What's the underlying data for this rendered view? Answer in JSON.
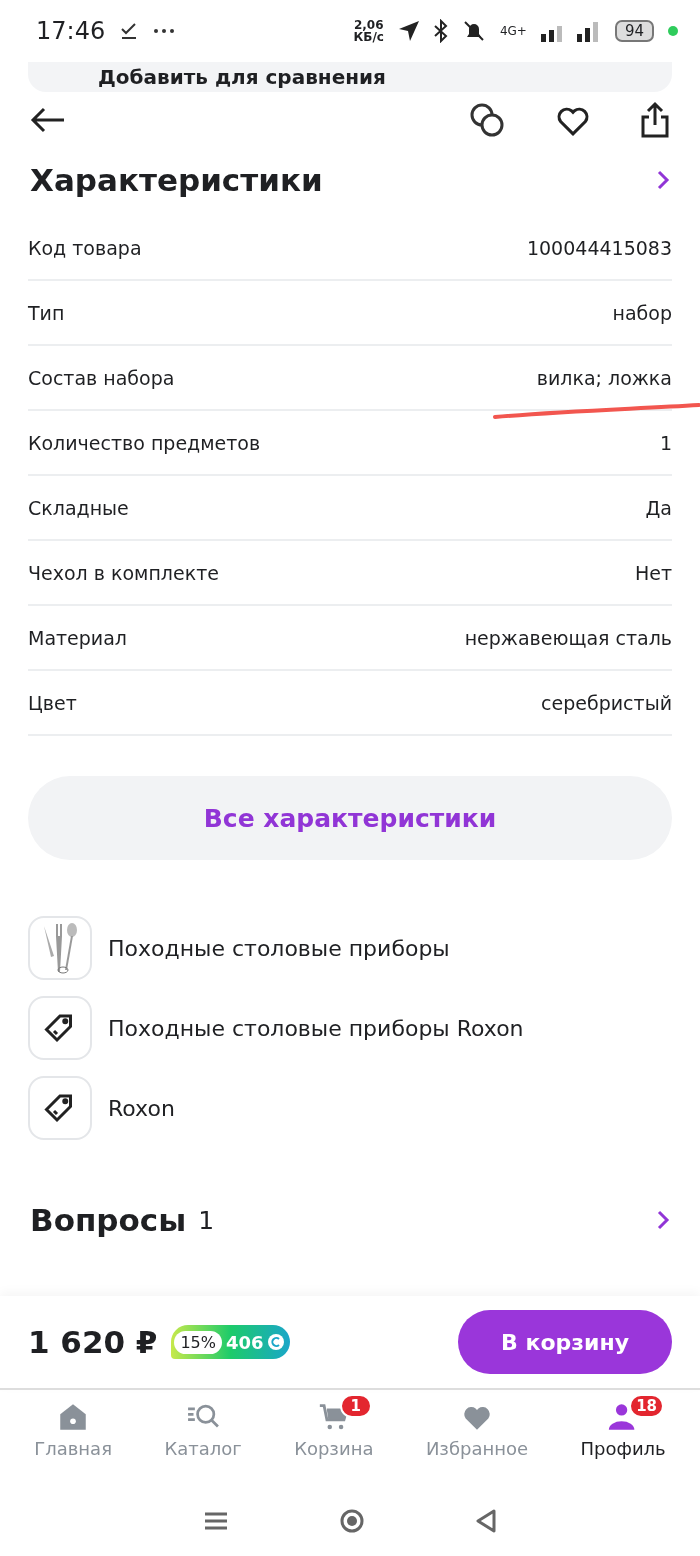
{
  "status_bar": {
    "time": "17:46",
    "speed": "2,06",
    "speed_unit": "КБ/с",
    "network": "4G+",
    "battery": "94"
  },
  "compare_banner": {
    "label": "Добавить для сравнения"
  },
  "specs": {
    "title": "Характеристики",
    "rows": [
      {
        "label": "Код товара",
        "value": "100044415083",
        "marked": false
      },
      {
        "label": "Тип",
        "value": "набор",
        "marked": false
      },
      {
        "label": "Состав набора",
        "value": "вилка; ложка",
        "marked": true
      },
      {
        "label": "Количество предметов",
        "value": "1",
        "marked": false
      },
      {
        "label": "Складные",
        "value": "Да",
        "marked": false
      },
      {
        "label": "Чехол в комплекте",
        "value": "Нет",
        "marked": false
      },
      {
        "label": "Материал",
        "value": "нержавеющая сталь",
        "marked": false
      },
      {
        "label": "Цвет",
        "value": "серебристый",
        "marked": false
      }
    ],
    "all_button": "Все характеристики"
  },
  "links": [
    {
      "kind": "category",
      "label": "Походные столовые приборы"
    },
    {
      "kind": "tag",
      "label": "Походные столовые приборы Roxon"
    },
    {
      "kind": "tag",
      "label": "Roxon"
    }
  ],
  "questions": {
    "title": "Вопросы",
    "count": "1"
  },
  "buy_bar": {
    "price": "1 620 ₽",
    "cashback_percent": "15%",
    "cashback_points": "406",
    "button": "В корзину"
  },
  "nav": [
    {
      "kind": "home",
      "label": "Главная",
      "selected": false
    },
    {
      "kind": "catalog",
      "label": "Каталог",
      "selected": false
    },
    {
      "kind": "cart",
      "label": "Корзина",
      "selected": false,
      "badge": "1"
    },
    {
      "kind": "favorites",
      "label": "Избранное",
      "selected": false
    },
    {
      "kind": "profile",
      "label": "Профиль",
      "selected": true,
      "badge": "18"
    }
  ]
}
